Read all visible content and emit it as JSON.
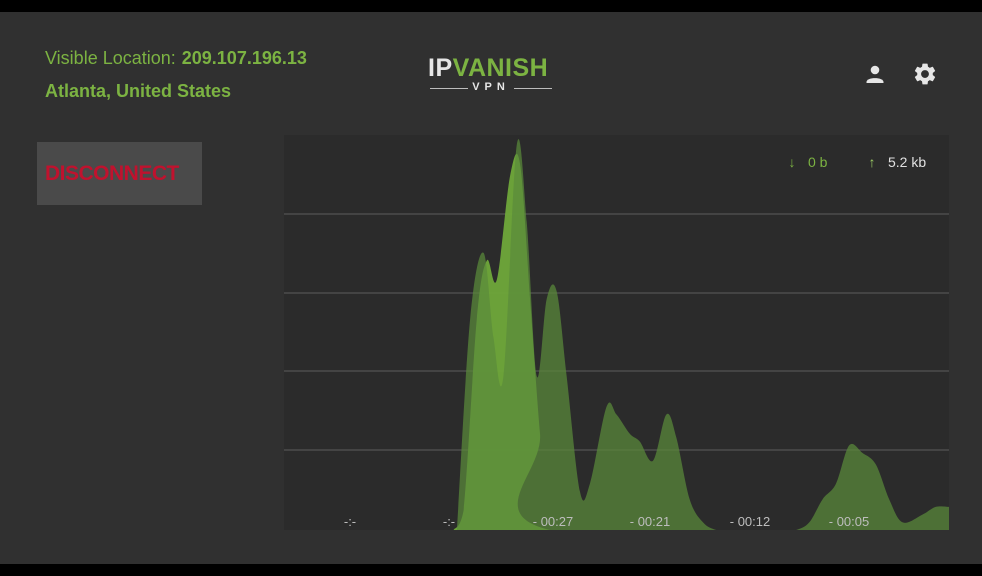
{
  "header": {
    "location_label": "Visible Location:",
    "ip_address": "209.107.196.13",
    "city": "Atlanta, United States"
  },
  "logo": {
    "brand_ip": "IP",
    "brand_vanish": "VANISH",
    "brand_vpn": "VPN"
  },
  "actions": {
    "profile_icon": "user-icon",
    "settings_icon": "gear-icon"
  },
  "connection": {
    "disconnect_label": "DISCONNECT"
  },
  "traffic": {
    "download_icon": "arrow-down-icon",
    "download_value": "0 b",
    "upload_icon": "arrow-up-icon",
    "upload_value": "5.2 kb"
  },
  "colors": {
    "accent_green": "#7cb342",
    "disconnect_red": "#c0122e",
    "background": "#303030",
    "upload_fill": "#5a8a3a",
    "download_fill": "#6fa83a"
  },
  "chart_data": {
    "type": "area",
    "x_tick_labels": [
      "-:-",
      "-:-",
      "- 00:27",
      "- 00:21",
      "- 00:12",
      "- 00:05"
    ],
    "grid": true,
    "legend": "top-right",
    "series": [
      {
        "name": "0 b",
        "x": [
          0.255,
          0.27,
          0.29,
          0.305,
          0.32,
          0.34,
          0.355,
          0.37,
          0.385,
          0.4,
          1.0
        ],
        "values": [
          0.0,
          0.05,
          0.55,
          0.7,
          0.65,
          0.92,
          0.95,
          0.6,
          0.25,
          0.0,
          0.0
        ]
      },
      {
        "name": "5.2 kb",
        "x": [
          0.26,
          0.28,
          0.3,
          0.315,
          0.33,
          0.35,
          0.365,
          0.38,
          0.395,
          0.41,
          0.425,
          0.445,
          0.46,
          0.485,
          0.5,
          0.52,
          0.535,
          0.555,
          0.575,
          0.59,
          0.61,
          0.63,
          0.65,
          0.67,
          0.69,
          0.72,
          0.75,
          0.77,
          0.79,
          0.81,
          0.83,
          0.85,
          0.87,
          0.89,
          0.91,
          0.93,
          0.96,
          0.98,
          1.0
        ],
        "values": [
          0.0,
          0.55,
          0.72,
          0.5,
          0.4,
          1.0,
          0.8,
          0.4,
          0.6,
          0.62,
          0.4,
          0.1,
          0.12,
          0.32,
          0.3,
          0.25,
          0.23,
          0.18,
          0.3,
          0.24,
          0.08,
          0.02,
          0.0,
          0.0,
          0.0,
          0.0,
          0.0,
          0.0,
          0.02,
          0.08,
          0.12,
          0.22,
          0.2,
          0.17,
          0.08,
          0.02,
          0.04,
          0.06,
          0.06
        ]
      }
    ]
  }
}
